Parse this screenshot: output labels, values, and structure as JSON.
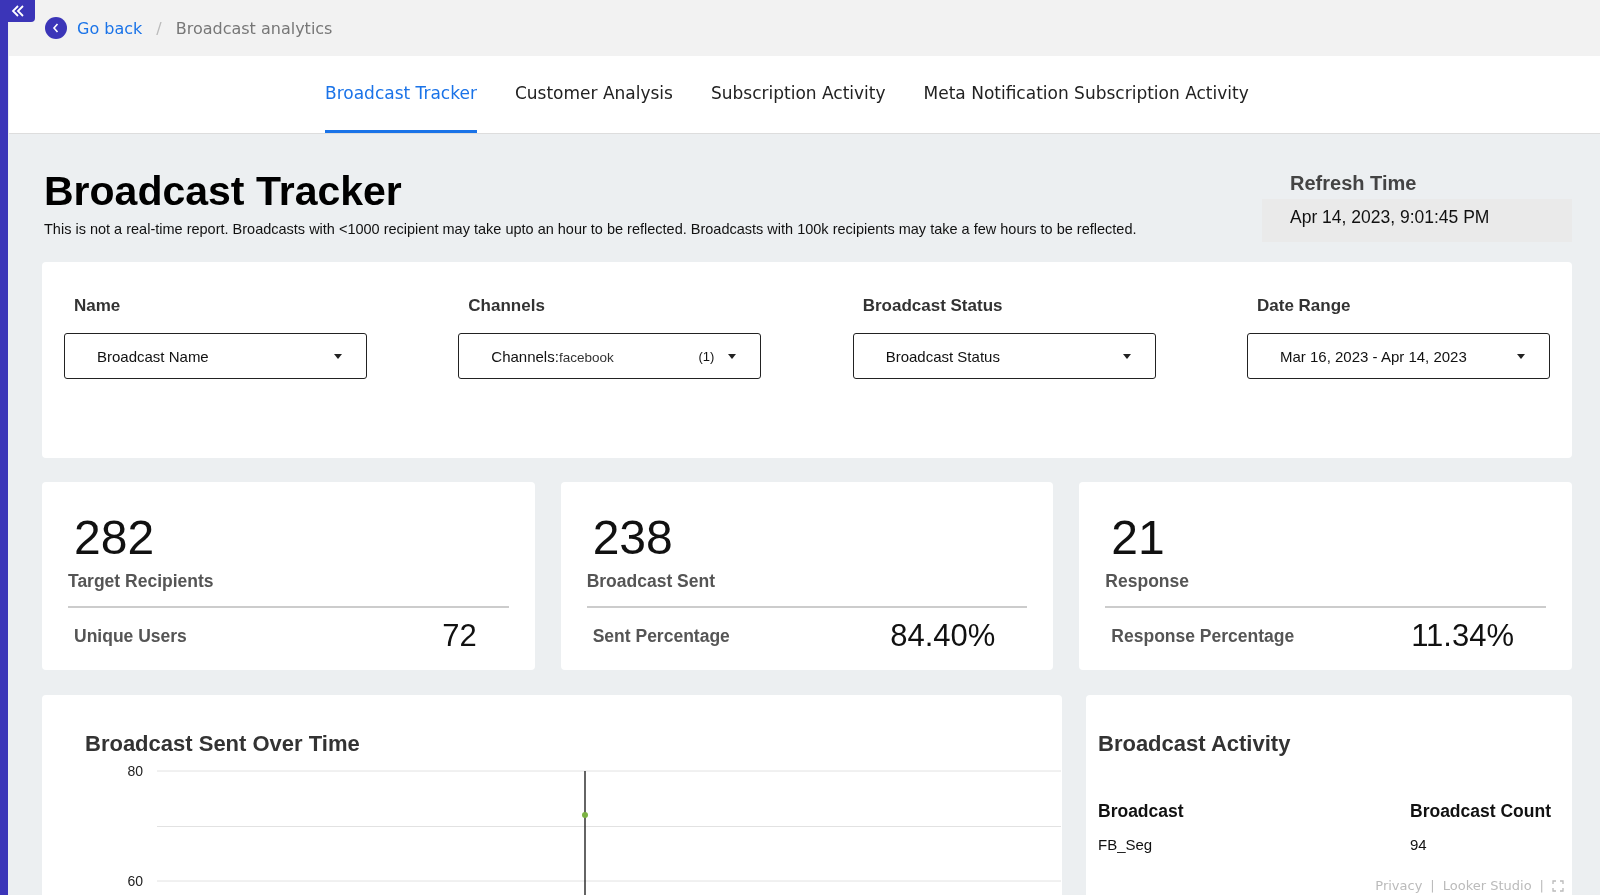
{
  "breadcrumb": {
    "back": "Go back",
    "separator": "/",
    "current": "Broadcast analytics"
  },
  "tabs": [
    {
      "label": "Broadcast Tracker",
      "selected": true
    },
    {
      "label": "Customer Analysis",
      "selected": false
    },
    {
      "label": "Subscription Activity",
      "selected": false
    },
    {
      "label": "Meta Notification Subscription Activity",
      "selected": false
    }
  ],
  "header": {
    "title": "Broadcast Tracker",
    "note": "This is not a real-time report. Broadcasts with <1000 recipient may take upto an hour to be reflected. Broadcasts with 100k recipients may take a few hours to be reflected.",
    "refresh_label": "Refresh Time",
    "refresh_value": "Apr 14, 2023, 9:01:45 PM"
  },
  "filters": [
    {
      "label": "Name",
      "value": "Broadcast Name"
    },
    {
      "label": "Channels",
      "value": "Channels:",
      "detail": "facebook",
      "count": "(1)"
    },
    {
      "label": "Broadcast Status",
      "value": "Broadcast Status"
    },
    {
      "label": "Date Range",
      "value": "Mar 16, 2023 - Apr 14, 2023"
    }
  ],
  "kpis": [
    {
      "value": "282",
      "label": "Target Recipients",
      "sub_label": "Unique Users",
      "sub_value": "72"
    },
    {
      "value": "238",
      "label": "Broadcast Sent",
      "sub_label": "Sent Percentage",
      "sub_value": "84.40%"
    },
    {
      "value": "21",
      "label": "Response",
      "sub_label": "Response Percentage",
      "sub_value": "11.34%"
    }
  ],
  "sent_chart": {
    "title": "Broadcast Sent Over Time",
    "chart_data": {
      "type": "line",
      "ylim": [
        60,
        80
      ],
      "yticks": [
        60,
        80
      ],
      "series": [
        {
          "color": "#7cb342",
          "marker": "circle",
          "values": [
            72
          ]
        }
      ]
    }
  },
  "activity": {
    "title": "Broadcast Activity",
    "columns": [
      "Broadcast",
      "Broadcast Count"
    ],
    "rows": [
      [
        "FB_Seg",
        "94"
      ]
    ]
  },
  "footer": {
    "links": [
      "Privacy",
      "Looker Studio"
    ],
    "separator": "|"
  }
}
